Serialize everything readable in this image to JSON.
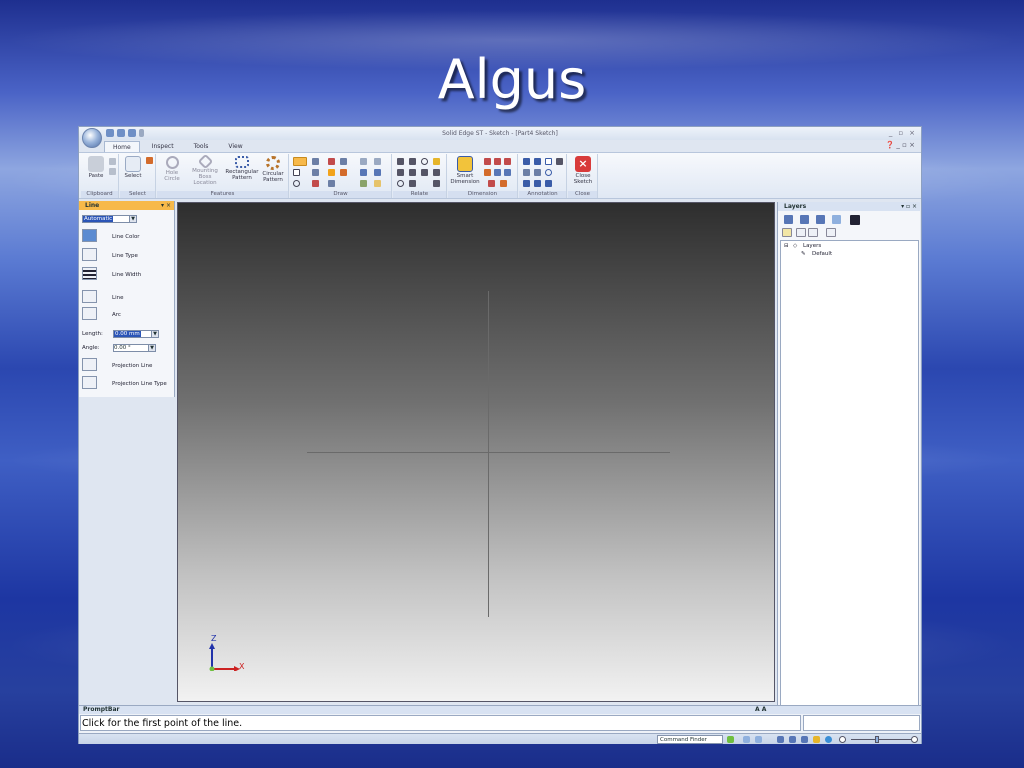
{
  "slide": {
    "title": "Algus"
  },
  "window": {
    "title": "Solid Edge ST - Sketch - [Part4 Sketch]",
    "controls": [
      "_",
      "▫",
      "×"
    ],
    "help_controls": "❓ _ ▫ ×"
  },
  "ribbon": {
    "tabs": [
      "Home",
      "Inspect",
      "Tools",
      "View"
    ],
    "active_tab": "Home",
    "groups": {
      "clipboard": {
        "label": "Clipboard",
        "paste": "Paste"
      },
      "select": {
        "label": "Select",
        "select": "Select"
      },
      "features": {
        "label": "Features",
        "hole": "Hole\nCircle",
        "mounting_boss": "Mounting Boss\nLocation",
        "rectangular": "Rectangular\nPattern",
        "circular": "Circular\nPattern"
      },
      "draw": {
        "label": "Draw"
      },
      "relate": {
        "label": "Relate"
      },
      "dimension": {
        "label": "Dimension",
        "smart": "Smart\nDimension"
      },
      "annotation": {
        "label": "Annotation"
      },
      "close": {
        "label": "Close",
        "close_sketch": "Close\nSketch"
      }
    }
  },
  "line_panel": {
    "title": "Line",
    "controls": "▾ ×",
    "style_value": "Automatic",
    "items": [
      "Line Color",
      "Line Type",
      "Line Width",
      "Line",
      "Arc"
    ],
    "length_label": "Length:",
    "length_value": "0.00 mm",
    "angle_label": "Angle:",
    "angle_value": "0.00 °",
    "projection_line": "Projection Line",
    "projection_line_type": "Projection Line Type"
  },
  "viewport": {
    "axis_z": "Z",
    "axis_x": "X"
  },
  "layers_panel": {
    "title": "Layers",
    "controls": "▾ ▫ ×",
    "tree_root": "Layers",
    "tree_child": "Default"
  },
  "prompt_bar": {
    "title": "PromptBar",
    "font_controls": "A  A",
    "text": "Click for the first point of the line."
  },
  "status_bar": {
    "command_finder": "Command Finder"
  },
  "colors": {
    "accent": "#f7b94a",
    "close_button": "#d83b3b",
    "selection": "#2b55b7"
  }
}
